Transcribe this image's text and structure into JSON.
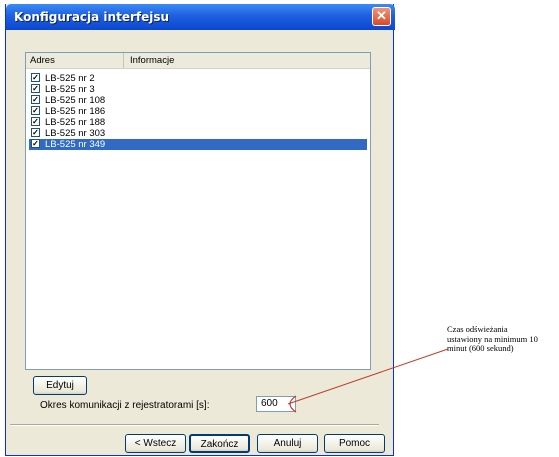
{
  "window": {
    "title": "Konfiguracja interfejsu",
    "close_glyph": "✕"
  },
  "list": {
    "columns": [
      "Adres",
      "Informacje"
    ],
    "rows": [
      {
        "label": "LB-525 nr 2",
        "checked": true,
        "selected": false
      },
      {
        "label": "LB-525 nr 3",
        "checked": true,
        "selected": false
      },
      {
        "label": "LB-525 nr 108",
        "checked": true,
        "selected": false
      },
      {
        "label": "LB-525 nr 186",
        "checked": true,
        "selected": false
      },
      {
        "label": "LB-525 nr 188",
        "checked": true,
        "selected": false
      },
      {
        "label": "LB-525 nr 303",
        "checked": true,
        "selected": false
      },
      {
        "label": "LB-525 nr 349",
        "checked": true,
        "selected": true
      }
    ],
    "check_glyph": "✓"
  },
  "edit_button": {
    "label": "Edytuj"
  },
  "period": {
    "label": "Okres komunikacji z rejestratorami [s]:",
    "value": "600"
  },
  "buttons": {
    "back": "< Wstecz",
    "finish": "Zakończ",
    "cancel": "Anuluj",
    "help": "Pomoc"
  },
  "annotation": {
    "lines": [
      "Czas odświeżania",
      "ustawiony na minimum 10",
      "minut (600 sekund)"
    ],
    "color": "#c0392b"
  },
  "colors": {
    "title_blue": "#0a48d2",
    "selection": "#316ac5",
    "dialog_bg": "#ece9d8"
  }
}
